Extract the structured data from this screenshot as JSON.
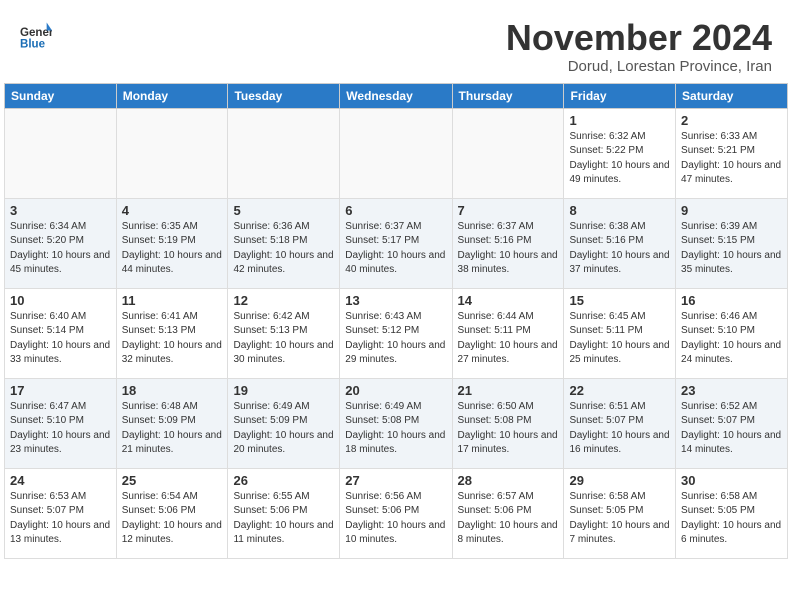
{
  "header": {
    "logo_general": "General",
    "logo_blue": "Blue",
    "month_title": "November 2024",
    "location": "Dorud, Lorestan Province, Iran"
  },
  "weekdays": [
    "Sunday",
    "Monday",
    "Tuesday",
    "Wednesday",
    "Thursday",
    "Friday",
    "Saturday"
  ],
  "weeks": [
    [
      {
        "day": "",
        "empty": true
      },
      {
        "day": "",
        "empty": true
      },
      {
        "day": "",
        "empty": true
      },
      {
        "day": "",
        "empty": true
      },
      {
        "day": "",
        "empty": true
      },
      {
        "day": "1",
        "sunrise": "6:32 AM",
        "sunset": "5:22 PM",
        "daylight": "10 hours and 49 minutes."
      },
      {
        "day": "2",
        "sunrise": "6:33 AM",
        "sunset": "5:21 PM",
        "daylight": "10 hours and 47 minutes."
      }
    ],
    [
      {
        "day": "3",
        "sunrise": "6:34 AM",
        "sunset": "5:20 PM",
        "daylight": "10 hours and 45 minutes."
      },
      {
        "day": "4",
        "sunrise": "6:35 AM",
        "sunset": "5:19 PM",
        "daylight": "10 hours and 44 minutes."
      },
      {
        "day": "5",
        "sunrise": "6:36 AM",
        "sunset": "5:18 PM",
        "daylight": "10 hours and 42 minutes."
      },
      {
        "day": "6",
        "sunrise": "6:37 AM",
        "sunset": "5:17 PM",
        "daylight": "10 hours and 40 minutes."
      },
      {
        "day": "7",
        "sunrise": "6:37 AM",
        "sunset": "5:16 PM",
        "daylight": "10 hours and 38 minutes."
      },
      {
        "day": "8",
        "sunrise": "6:38 AM",
        "sunset": "5:16 PM",
        "daylight": "10 hours and 37 minutes."
      },
      {
        "day": "9",
        "sunrise": "6:39 AM",
        "sunset": "5:15 PM",
        "daylight": "10 hours and 35 minutes."
      }
    ],
    [
      {
        "day": "10",
        "sunrise": "6:40 AM",
        "sunset": "5:14 PM",
        "daylight": "10 hours and 33 minutes."
      },
      {
        "day": "11",
        "sunrise": "6:41 AM",
        "sunset": "5:13 PM",
        "daylight": "10 hours and 32 minutes."
      },
      {
        "day": "12",
        "sunrise": "6:42 AM",
        "sunset": "5:13 PM",
        "daylight": "10 hours and 30 minutes."
      },
      {
        "day": "13",
        "sunrise": "6:43 AM",
        "sunset": "5:12 PM",
        "daylight": "10 hours and 29 minutes."
      },
      {
        "day": "14",
        "sunrise": "6:44 AM",
        "sunset": "5:11 PM",
        "daylight": "10 hours and 27 minutes."
      },
      {
        "day": "15",
        "sunrise": "6:45 AM",
        "sunset": "5:11 PM",
        "daylight": "10 hours and 25 minutes."
      },
      {
        "day": "16",
        "sunrise": "6:46 AM",
        "sunset": "5:10 PM",
        "daylight": "10 hours and 24 minutes."
      }
    ],
    [
      {
        "day": "17",
        "sunrise": "6:47 AM",
        "sunset": "5:10 PM",
        "daylight": "10 hours and 23 minutes."
      },
      {
        "day": "18",
        "sunrise": "6:48 AM",
        "sunset": "5:09 PM",
        "daylight": "10 hours and 21 minutes."
      },
      {
        "day": "19",
        "sunrise": "6:49 AM",
        "sunset": "5:09 PM",
        "daylight": "10 hours and 20 minutes."
      },
      {
        "day": "20",
        "sunrise": "6:49 AM",
        "sunset": "5:08 PM",
        "daylight": "10 hours and 18 minutes."
      },
      {
        "day": "21",
        "sunrise": "6:50 AM",
        "sunset": "5:08 PM",
        "daylight": "10 hours and 17 minutes."
      },
      {
        "day": "22",
        "sunrise": "6:51 AM",
        "sunset": "5:07 PM",
        "daylight": "10 hours and 16 minutes."
      },
      {
        "day": "23",
        "sunrise": "6:52 AM",
        "sunset": "5:07 PM",
        "daylight": "10 hours and 14 minutes."
      }
    ],
    [
      {
        "day": "24",
        "sunrise": "6:53 AM",
        "sunset": "5:07 PM",
        "daylight": "10 hours and 13 minutes."
      },
      {
        "day": "25",
        "sunrise": "6:54 AM",
        "sunset": "5:06 PM",
        "daylight": "10 hours and 12 minutes."
      },
      {
        "day": "26",
        "sunrise": "6:55 AM",
        "sunset": "5:06 PM",
        "daylight": "10 hours and 11 minutes."
      },
      {
        "day": "27",
        "sunrise": "6:56 AM",
        "sunset": "5:06 PM",
        "daylight": "10 hours and 10 minutes."
      },
      {
        "day": "28",
        "sunrise": "6:57 AM",
        "sunset": "5:06 PM",
        "daylight": "10 hours and 8 minutes."
      },
      {
        "day": "29",
        "sunrise": "6:58 AM",
        "sunset": "5:05 PM",
        "daylight": "10 hours and 7 minutes."
      },
      {
        "day": "30",
        "sunrise": "6:58 AM",
        "sunset": "5:05 PM",
        "daylight": "10 hours and 6 minutes."
      }
    ]
  ]
}
